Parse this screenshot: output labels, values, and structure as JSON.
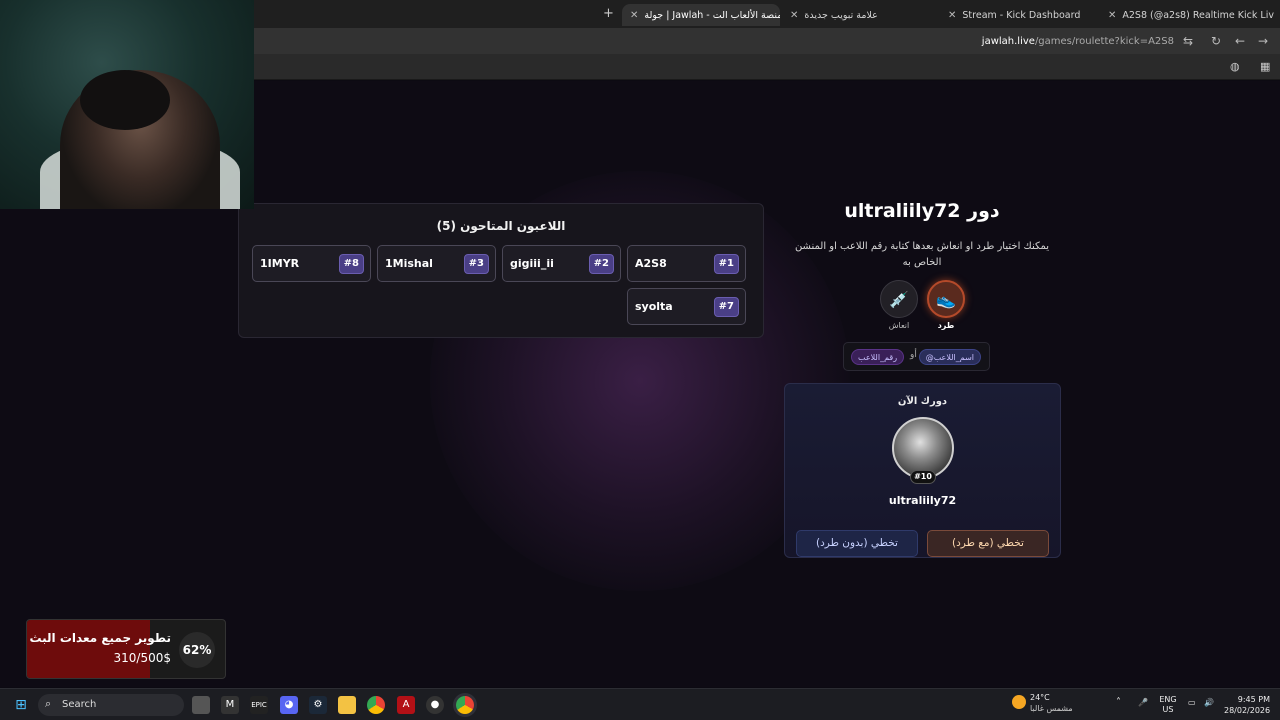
{
  "browser": {
    "tabs": [
      {
        "label": "A2S8 (@a2s8) Realtime Kick Liv",
        "color": "#e03c3c"
      },
      {
        "label": "Stream - Kick Dashboard",
        "color": "#53fc18"
      },
      {
        "label": "علامة تبويب جديدة",
        "color": "#9aa0a6"
      },
      {
        "label": "جولة | Jawlah - منصة الألعاب الت",
        "color": "#c9b38a"
      }
    ],
    "url_domain": "jawlah.live",
    "url_path": "/games/roulette?kick=A2S8"
  },
  "players": {
    "title": "اللاعبون المتاحون (5)",
    "list": [
      {
        "name": "A2S8",
        "num": "#1"
      },
      {
        "name": "gigiii_ii",
        "num": "#2"
      },
      {
        "name": "1Mishal",
        "num": "#3"
      },
      {
        "name": "1IMYR",
        "num": "#8"
      },
      {
        "name": "syolta",
        "num": "#7"
      }
    ]
  },
  "turn": {
    "title": "دور ultraliily72",
    "description": "يمكنك اختيار طرد او انعاش بعدها كتابة رقم اللاعب او المنشن الخاص به",
    "kick_label": "طرد",
    "revive_label": "انعاش",
    "chip_name": "@اسم_اللاعب",
    "chip_number": "رقم_اللاعب",
    "or": "أو"
  },
  "current": {
    "title": "دورك الآن",
    "badge": "#10",
    "name": "ultraliily72",
    "skip_with_kick": "تخطي (مع طرد)",
    "skip_without_kick": "تخطي (بدون طرد)"
  },
  "donation": {
    "title": "تطوير جميع معدات البث",
    "amount": "310/500$",
    "percent": "62%",
    "progress": 0.62
  },
  "taskbar": {
    "search": "Search",
    "weather_temp": "24°C",
    "weather_cond": "مشمس غالبا",
    "lang_top": "ENG",
    "lang_bottom": "US",
    "time": "9:45 PM",
    "date": "28/02/2026"
  }
}
